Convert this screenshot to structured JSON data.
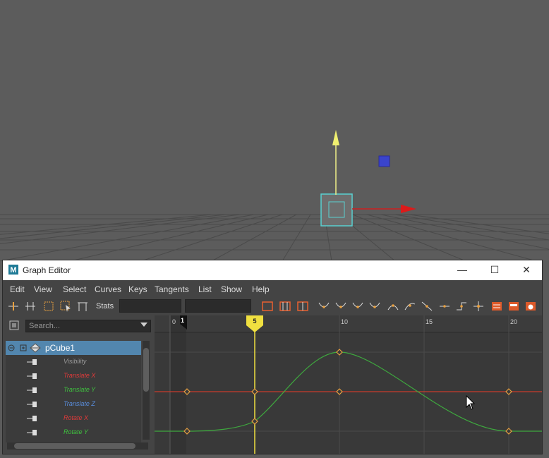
{
  "window": {
    "title": "Graph Editor",
    "logo_letter": "M",
    "minimize_glyph": "—",
    "maximize_glyph": "☐",
    "close_glyph": "✕"
  },
  "menu": [
    "Edit",
    "View",
    "Select",
    "Curves",
    "Keys",
    "Tangents",
    "List",
    "Show",
    "Help"
  ],
  "toolbar": {
    "stats_label": "Stats",
    "stats_field_1": "",
    "stats_field_2": ""
  },
  "outliner": {
    "search_placeholder": "Search...",
    "node": "pCube1",
    "attributes": [
      {
        "label": "Visibility",
        "color": "#9a9a9a"
      },
      {
        "label": "Translate X",
        "color": "#e03a3a"
      },
      {
        "label": "Translate Y",
        "color": "#3fc23f"
      },
      {
        "label": "Translate Z",
        "color": "#5a8fe0"
      },
      {
        "label": "Rotate X",
        "color": "#e03a3a"
      },
      {
        "label": "Rotate Y",
        "color": "#3fc23f"
      }
    ]
  },
  "timeline": {
    "ticks": [
      "0",
      "10",
      "15",
      "20"
    ],
    "start_marker": "1",
    "current_frame": "5"
  },
  "colors": {
    "current_time": "#f0e040",
    "key": "#e8a040",
    "translate_x_curve": "#c83c2c",
    "translate_y_curve": "#3ea83e",
    "selection": "#5286ae"
  }
}
